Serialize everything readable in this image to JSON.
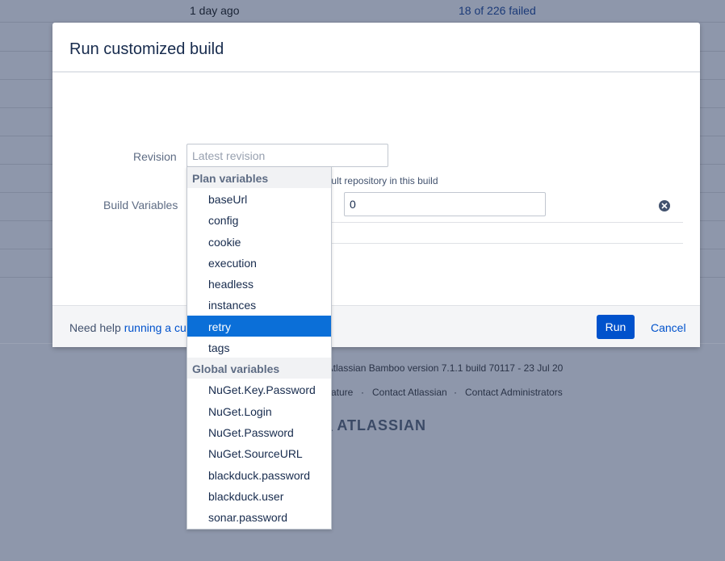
{
  "background": {
    "row_time": "1 day ago",
    "row_status": "18 of 226 failed",
    "footer_version_partial": "y Atlassian Bamboo version 7.1.1 build 70117 - 23 Jul 20",
    "footer_feature_partial": "ature",
    "footer_contact_atlassian": "Contact Atlassian",
    "footer_contact_admins": "Contact Administrators",
    "footer_dot": "·",
    "logo_text": "ATLASSIAN"
  },
  "dialog": {
    "title": "Run customized build",
    "revision_label": "Revision",
    "revision_placeholder": "Latest revision",
    "revision_hint": "Use a specific revision of the default repository in this build",
    "build_variables_label": "Build Variables",
    "selected_variable": "retry",
    "variable_value": "0",
    "help_prefix": "Need help",
    "help_link": "running a cus",
    "run_label": "Run",
    "cancel_label": "Cancel"
  },
  "dropdown": {
    "groups": [
      {
        "header": "Plan variables",
        "options": [
          "baseUrl",
          "config",
          "cookie",
          "execution",
          "headless",
          "instances",
          "retry",
          "tags"
        ]
      },
      {
        "header": "Global variables",
        "options": [
          "NuGet.Key.Password",
          "NuGet.Login",
          "NuGet.Password",
          "NuGet.SourceURL",
          "blackduck.password",
          "blackduck.user",
          "sonar.password"
        ]
      }
    ],
    "selected": "retry"
  },
  "colors": {
    "accent": "#0052cc",
    "selected_option": "#0b6fd8",
    "overlay": "#8e97ab"
  }
}
